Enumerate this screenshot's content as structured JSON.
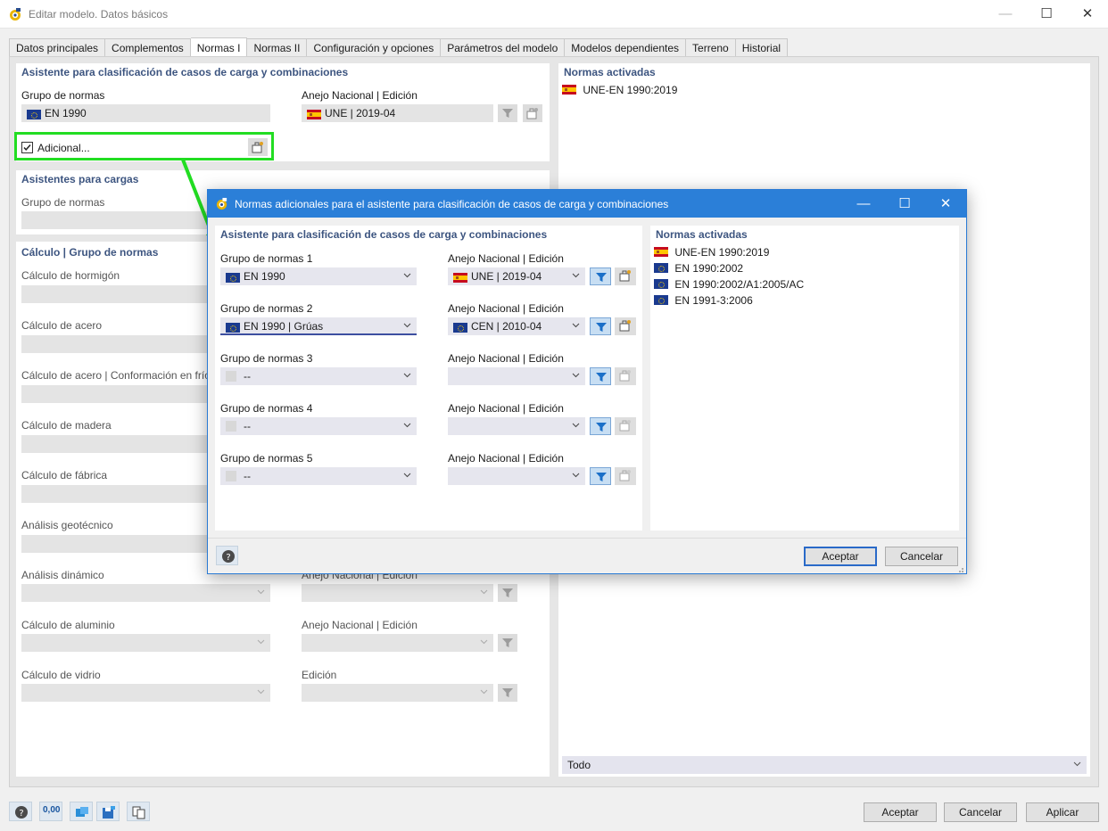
{
  "window": {
    "title": "Editar modelo. Datos básicos",
    "minimize": "—",
    "maximize": "☐",
    "close": "✕"
  },
  "tabs": [
    "Datos principales",
    "Complementos",
    "Normas I",
    "Normas II",
    "Configuración y opciones",
    "Parámetros del modelo",
    "Modelos dependientes",
    "Terreno",
    "Historial"
  ],
  "active_tab": "Normas I",
  "wizard_section": {
    "title": "Asistente para clasificación de casos de carga y combinaciones",
    "group_label": "Grupo de normas",
    "group_value": "EN 1990",
    "annex_label": "Anejo Nacional | Edición",
    "annex_value": "UNE | 2019-04",
    "additional_label": "Adicional..."
  },
  "loads_section": {
    "title": "Asistentes para cargas",
    "group_label": "Grupo de normas"
  },
  "calc_section": {
    "title": "Cálculo | Grupo de normas",
    "items": [
      {
        "label": "Cálculo de hormigón",
        "annex_label": ""
      },
      {
        "label": "Cálculo de acero",
        "annex_label": ""
      },
      {
        "label": "Cálculo de acero | Conformación en frío",
        "annex_label": ""
      },
      {
        "label": "Cálculo de madera",
        "annex_label": ""
      },
      {
        "label": "Cálculo de fábrica",
        "annex_label": ""
      },
      {
        "label": "Análisis geotécnico",
        "annex_label": ""
      },
      {
        "label": "Análisis dinámico",
        "annex_label": "Anejo Nacional | Edición"
      },
      {
        "label": "Cálculo de aluminio",
        "annex_label": "Anejo Nacional | Edición"
      },
      {
        "label": "Cálculo de vidrio",
        "annex_label": "Edición"
      }
    ]
  },
  "active_norms": {
    "title": "Normas activadas",
    "items": [
      "UNE-EN 1990:2019"
    ],
    "footer_select": "Todo"
  },
  "dialog": {
    "title": "Normas adicionales para el asistente para clasificación de casos de carga y combinaciones",
    "section_title": "Asistente para clasificación de casos de carga y combinaciones",
    "annex_label": "Anejo Nacional | Edición",
    "groups": [
      {
        "label": "Grupo de normas 1",
        "value": "EN 1990",
        "flag": "eu",
        "annex": "UNE | 2019-04",
        "annex_flag": "es"
      },
      {
        "label": "Grupo de normas 2",
        "value": "EN 1990 | Grúas",
        "flag": "eu",
        "annex": "CEN | 2010-04",
        "annex_flag": "eu"
      },
      {
        "label": "Grupo de normas 3",
        "value": "--",
        "flag": "none",
        "annex": "",
        "annex_flag": "none"
      },
      {
        "label": "Grupo de normas 4",
        "value": "--",
        "flag": "none",
        "annex": "",
        "annex_flag": "none"
      },
      {
        "label": "Grupo de normas 5",
        "value": "--",
        "flag": "none",
        "annex": "",
        "annex_flag": "none"
      }
    ],
    "active_title": "Normas activadas",
    "active_items": [
      {
        "text": "UNE-EN 1990:2019",
        "flag": "es"
      },
      {
        "text": "EN 1990:2002",
        "flag": "eu"
      },
      {
        "text": "EN 1990:2002/A1:2005/AC",
        "flag": "eu"
      },
      {
        "text": "EN 1991-3:2006",
        "flag": "eu"
      }
    ],
    "ok": "Aceptar",
    "cancel": "Cancelar"
  },
  "bottom": {
    "ok": "Aceptar",
    "cancel": "Cancelar",
    "apply": "Aplicar",
    "units_label": "0,00"
  }
}
